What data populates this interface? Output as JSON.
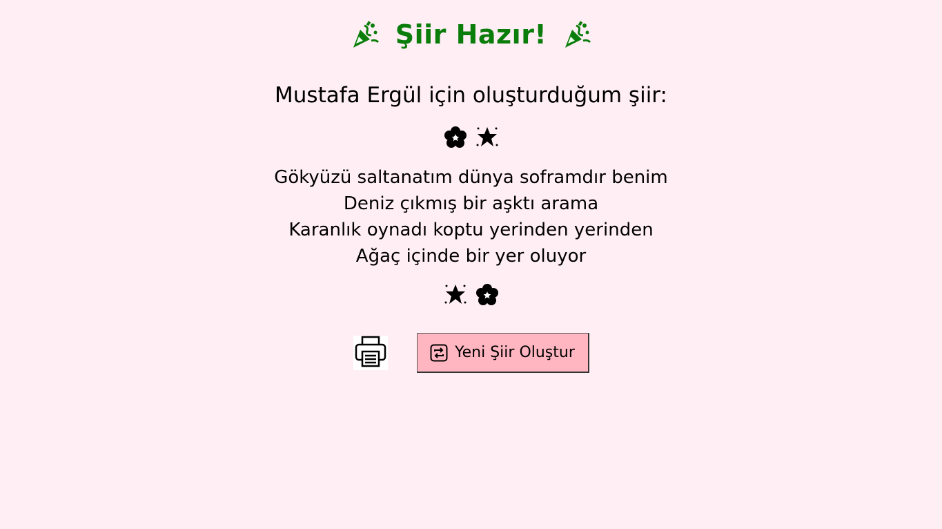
{
  "header": {
    "title": "Şiir Hazır!",
    "left_icon": "party-popper-icon",
    "right_icon": "party-popper-icon",
    "title_color": "#0b7d0b"
  },
  "intro": {
    "text": "Mustafa Ergül için oluşturduğum şiir:"
  },
  "decorations": {
    "top": [
      "flower-icon",
      "star-icon"
    ],
    "bottom": [
      "star-icon",
      "flower-icon"
    ]
  },
  "poem": {
    "lines": [
      "Gökyüzü saltanatım dünya soframdır benim",
      "Deniz çıkmış bir aşktı arama",
      "Karanlık oynadı koptu yerinden yerinden",
      "Ağaç içinde bir yer oluyor"
    ]
  },
  "actions": {
    "print_icon": "printer-icon",
    "new_poem_label": "Yeni Şiir Oluştur",
    "new_poem_icon": "repeat-icon",
    "button_color": "#ffb6c1"
  },
  "colors": {
    "background": "#ffeef4"
  }
}
